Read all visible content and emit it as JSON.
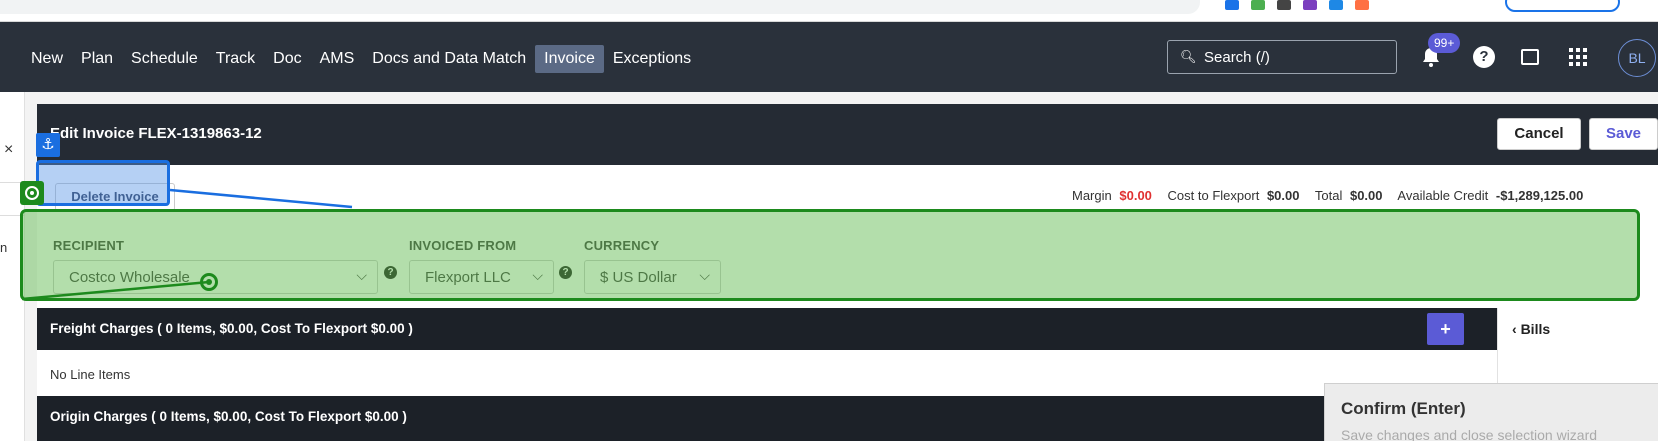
{
  "nav": {
    "items": [
      "New",
      "Plan",
      "Schedule",
      "Track",
      "Doc",
      "AMS",
      "Docs and Data Match",
      "Invoice",
      "Exceptions"
    ],
    "active": "Invoice",
    "search_placeholder": "Search (/)",
    "notification_badge": "99+",
    "help_label": "?",
    "avatar_initials": "BL"
  },
  "sidebar": {
    "close_label": "×",
    "partial_text": "n"
  },
  "modal": {
    "title": "Edit Invoice FLEX-1319863-12",
    "cancel_label": "Cancel",
    "save_label": "Save",
    "delete_label": "Delete Invoice",
    "totals": {
      "margin_label": "Margin",
      "margin_value": "$0.00",
      "cost_label": "Cost to Flexport",
      "cost_value": "$0.00",
      "total_label": "Total",
      "total_value": "$0.00",
      "credit_label": "Available Credit",
      "credit_value": "-$1,289,125.00"
    },
    "fields": {
      "recipient_label": "RECIPIENT",
      "recipient_value": "Costco Wholesale",
      "invoiced_from_label": "INVOICED FROM",
      "invoiced_from_value": "Flexport LLC",
      "currency_label": "CURRENCY",
      "currency_value": "$ US Dollar"
    },
    "sections": {
      "freight_label": "Freight Charges ( 0 Items, $0.00, Cost To Flexport $0.00 )",
      "no_items_label": "No Line Items",
      "origin_label": "Origin Charges ( 0 Items, $0.00, Cost To Flexport $0.00 )",
      "add_label": "+"
    },
    "bills_label": "Bills",
    "bills_chevron": "‹"
  },
  "tooltip": {
    "title": "Confirm (Enter)",
    "subtitle": "Save changes and close selection wizard"
  },
  "colors": {
    "nav_bg": "#2a313b",
    "accent": "#5b5bd6",
    "negative": "#e03131",
    "overlay_green": "#1d8a1d",
    "overlay_blue": "#1a6ee0"
  }
}
